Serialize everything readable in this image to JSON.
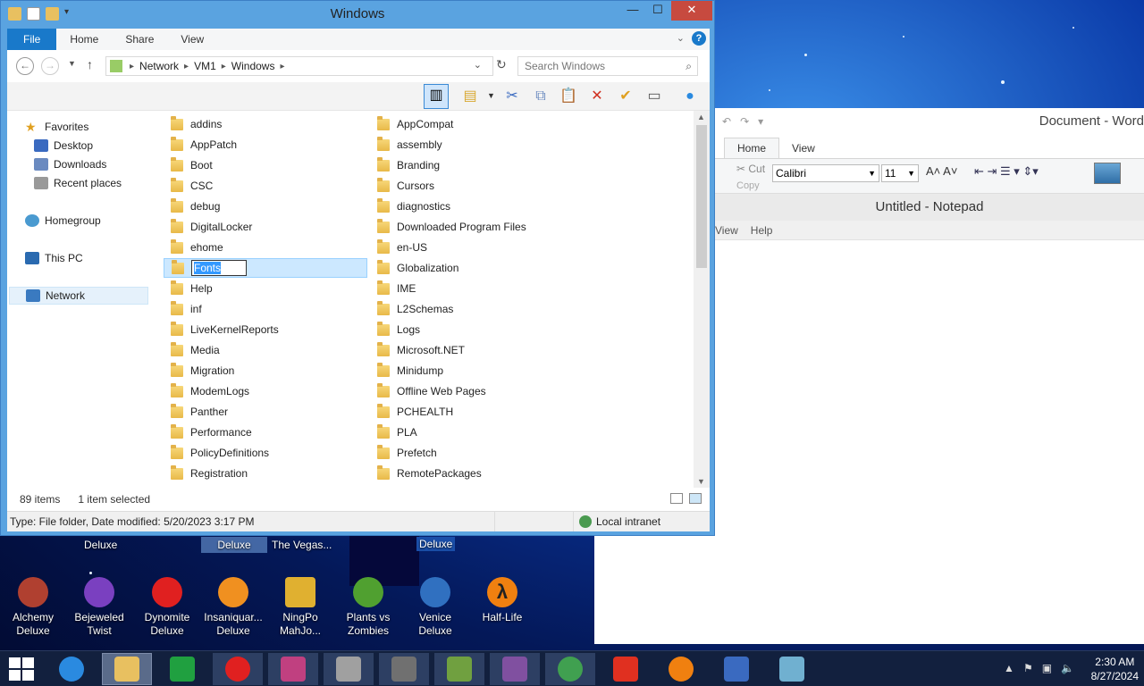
{
  "explorer": {
    "title": "Windows",
    "ribbon_tabs": [
      "File",
      "Home",
      "Share",
      "View"
    ],
    "help": "?",
    "address": [
      "Network",
      "VM1",
      "Windows"
    ],
    "search_placeholder": "Search Windows",
    "nav": {
      "favorites": "Favorites",
      "desktop": "Desktop",
      "downloads": "Downloads",
      "recent": "Recent places",
      "homegroup": "Homegroup",
      "thispc": "This PC",
      "network": "Network"
    },
    "col1": [
      "addins",
      "AppPatch",
      "Boot",
      "CSC",
      "debug",
      "DigitalLocker",
      "ehome",
      "Fonts",
      "Help",
      "inf",
      "LiveKernelReports",
      "Media",
      "Migration",
      "ModemLogs",
      "Panther",
      "Performance",
      "PolicyDefinitions",
      "Registration"
    ],
    "col2": [
      "AppCompat",
      "assembly",
      "Branding",
      "Cursors",
      "diagnostics",
      "Downloaded Program Files",
      "en-US",
      "Globalization",
      "IME",
      "L2Schemas",
      "Logs",
      "Microsoft.NET",
      "Minidump",
      "Offline Web Pages",
      "PCHEALTH",
      "PLA",
      "Prefetch",
      "RemotePackages"
    ],
    "rename_value": "Fonts",
    "item_count": "89 items",
    "selected_count": "1 item selected",
    "details": "Type: File folder, Date modified: 5/20/2023 3:17 PM",
    "zone": "Local intranet"
  },
  "word": {
    "title": "Document - Word",
    "tabs": [
      "Home",
      "View"
    ],
    "cut": "Cut",
    "copy": "Copy",
    "font": "Calibri",
    "size": "11"
  },
  "notepad": {
    "title": "Untitled - Notepad",
    "menu": [
      "View",
      "Help"
    ]
  },
  "desktop": {
    "top_labels": [
      "Deluxe",
      "Deluxe",
      "The Vegas...",
      "Deluxe"
    ],
    "icons": [
      {
        "line1": "Alchemy",
        "line2": "Deluxe",
        "color": "#b04030"
      },
      {
        "line1": "Bejeweled",
        "line2": "Twist",
        "color": "#7a40c0"
      },
      {
        "line1": "Dynomite",
        "line2": "Deluxe",
        "color": "#e02020"
      },
      {
        "line1": "Insaniquar...",
        "line2": "Deluxe",
        "color": "#f09020"
      },
      {
        "line1": "NingPo",
        "line2": "MahJo...",
        "color": "#e0b030"
      },
      {
        "line1": "Plants vs",
        "line2": "Zombies",
        "color": "#50a030"
      },
      {
        "line1": "Venice",
        "line2": "Deluxe",
        "color": "#3070c0"
      },
      {
        "line1": "Half-Life",
        "line2": "",
        "color": "#f08010"
      }
    ]
  },
  "taskbar": {
    "time": "2:30 AM",
    "date": "8/27/2024",
    "apps": [
      {
        "name": "internet-explorer",
        "color": "#2a8ae0"
      },
      {
        "name": "file-explorer",
        "color": "#e8c060"
      },
      {
        "name": "store",
        "color": "#20a040"
      },
      {
        "name": "dynomite",
        "color": "#e02020"
      },
      {
        "name": "pop-game",
        "color": "#c04080"
      },
      {
        "name": "robot-game",
        "color": "#a0a0a0"
      },
      {
        "name": "pirate-game",
        "color": "#707070"
      },
      {
        "name": "plants-game",
        "color": "#70a040"
      },
      {
        "name": "wizard-game",
        "color": "#8050a0"
      },
      {
        "name": "chrome",
        "color": "#40a050"
      },
      {
        "name": "shapes-app",
        "color": "#e03020"
      },
      {
        "name": "half-life",
        "color": "#f08010"
      },
      {
        "name": "wordpad",
        "color": "#3a6ac0"
      },
      {
        "name": "notepad",
        "color": "#70b0d0"
      }
    ]
  }
}
